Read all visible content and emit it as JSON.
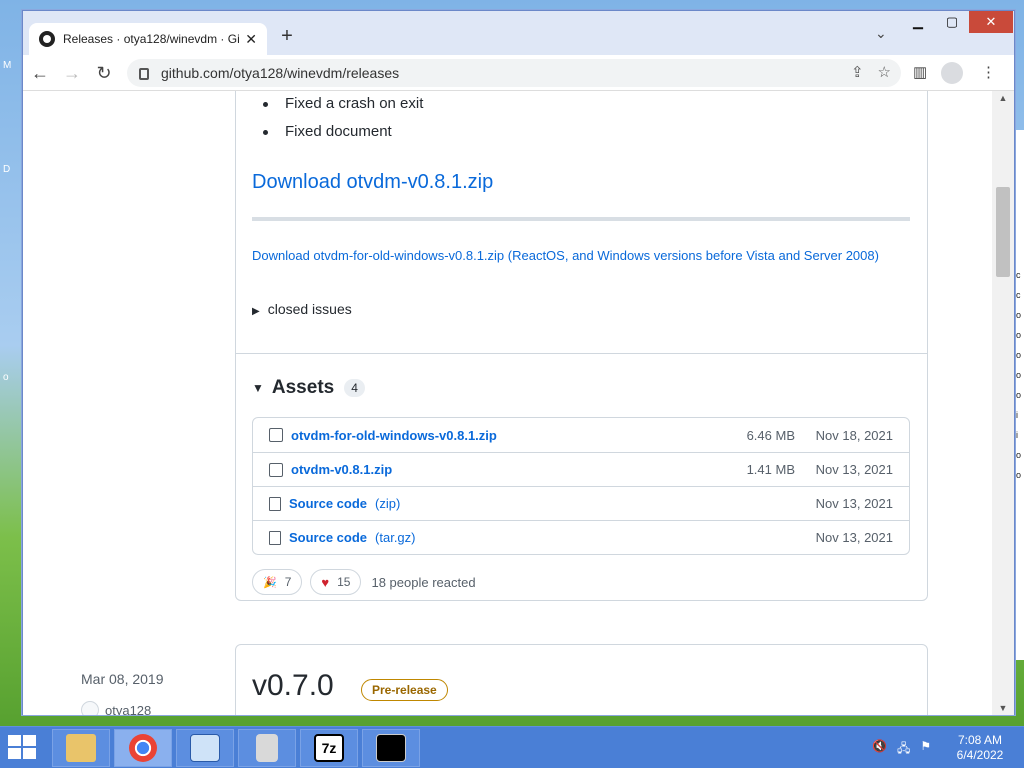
{
  "window": {
    "tab_title": "Releases · otya128/winevdm · Gi",
    "url": "github.com/otya128/winevdm/releases",
    "controls": {
      "min": "▁",
      "max": "▢",
      "close": "✕"
    }
  },
  "release": {
    "bullets": [
      "Fixed a crash on exit",
      "Fixed document"
    ],
    "download_heading": "Download otvdm-v0.8.1.zip",
    "download_old": "Download otvdm-for-old-windows-v0.8.1.zip (ReactOS, and Windows versions before Vista and Server 2008)",
    "closed_issues": "closed issues",
    "assets_label": "Assets",
    "assets_count": "4",
    "assets": [
      {
        "name": "otvdm-for-old-windows-v0.8.1.zip",
        "sub": "",
        "size": "6.46 MB",
        "date": "Nov 18, 2021",
        "icon": "package-icon"
      },
      {
        "name": "otvdm-v0.8.1.zip",
        "sub": "",
        "size": "1.41 MB",
        "date": "Nov 13, 2021",
        "icon": "package-icon"
      },
      {
        "name": "Source code",
        "sub": "(zip)",
        "size": "",
        "date": "Nov 13, 2021",
        "icon": "file-zip-icon"
      },
      {
        "name": "Source code",
        "sub": "(tar.gz)",
        "size": "",
        "date": "Nov 13, 2021",
        "icon": "file-zip-icon"
      }
    ],
    "reactions": {
      "tada": "7",
      "heart": "15",
      "summary": "18 people reacted"
    }
  },
  "next_release": {
    "date": "Mar 08, 2019",
    "author": "otya128",
    "version": "v0.7.0",
    "badge": "Pre-release"
  },
  "taskbar": {
    "time": "7:08 AM",
    "date": "6/4/2022"
  }
}
